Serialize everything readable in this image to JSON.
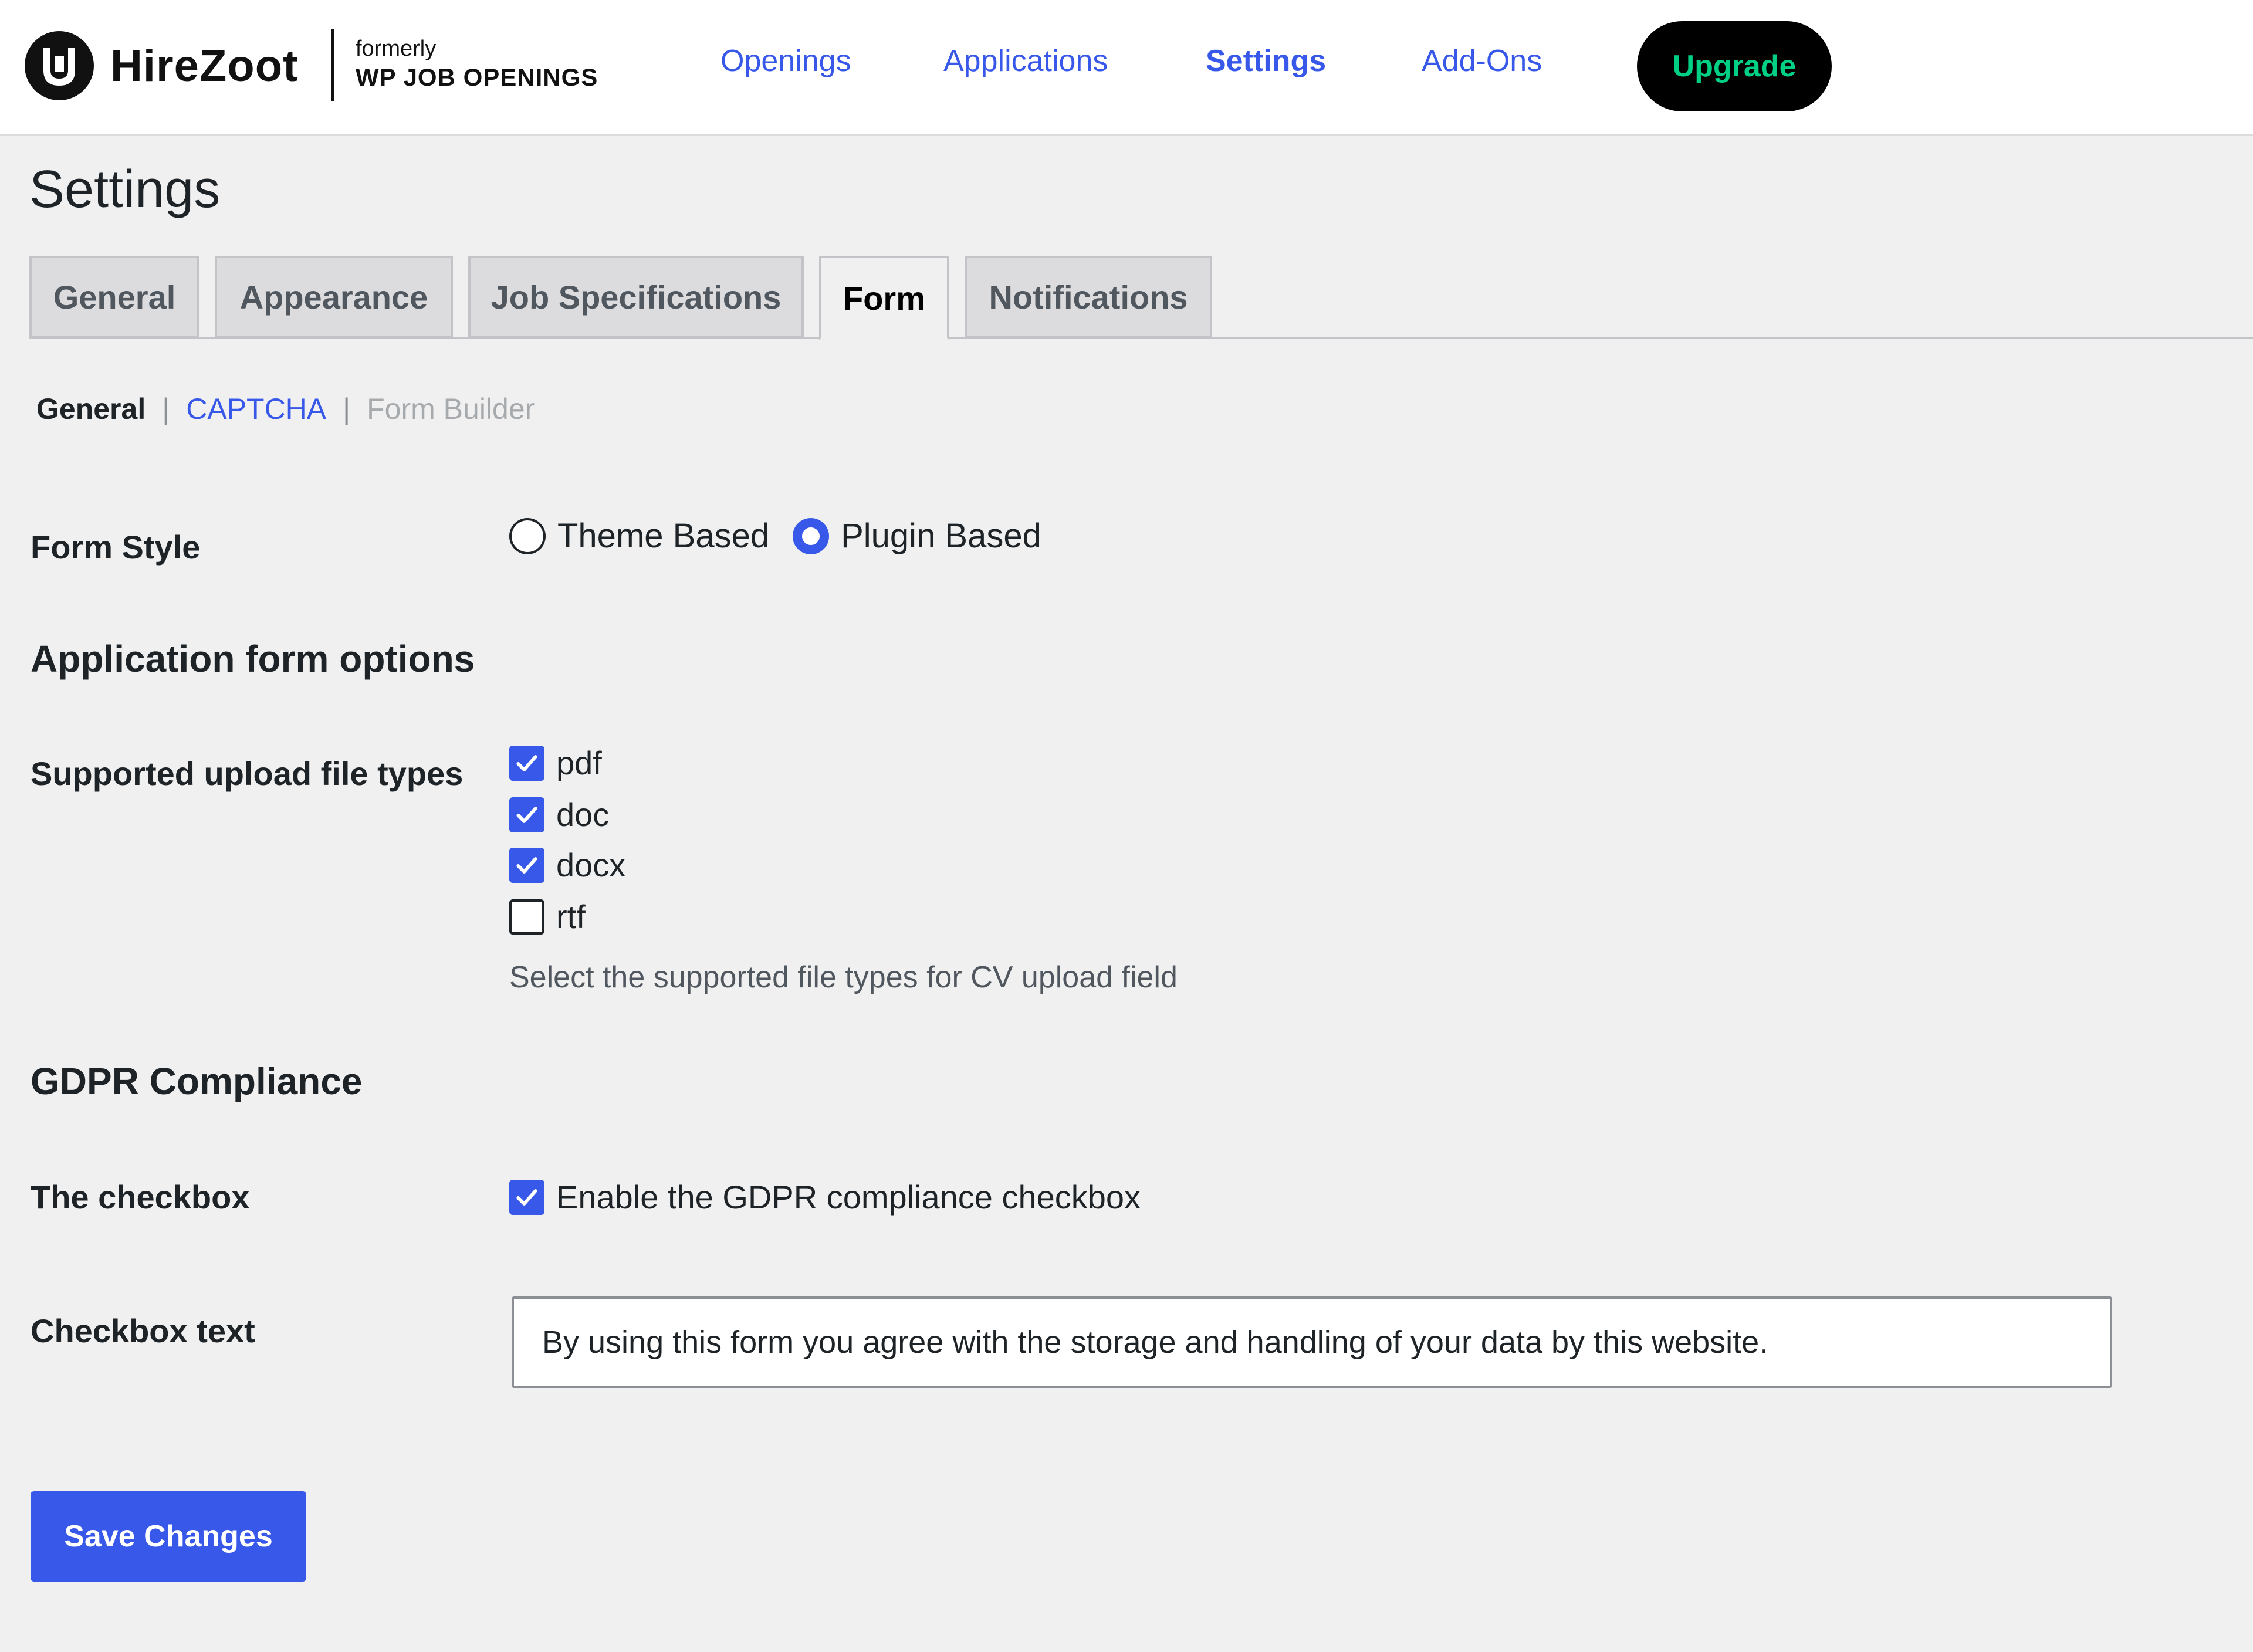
{
  "brand": {
    "name": "HireZoot",
    "formerly": "formerly",
    "old_name": "WP JOB OPENINGS"
  },
  "nav": {
    "items": [
      {
        "label": "Openings",
        "active": false
      },
      {
        "label": "Applications",
        "active": false
      },
      {
        "label": "Settings",
        "active": true
      },
      {
        "label": "Add-Ons",
        "active": false
      }
    ],
    "upgrade_label": "Upgrade"
  },
  "page": {
    "title": "Settings"
  },
  "tabs": [
    {
      "label": "General",
      "active": false
    },
    {
      "label": "Appearance",
      "active": false
    },
    {
      "label": "Job Specifications",
      "active": false
    },
    {
      "label": "Form",
      "active": true
    },
    {
      "label": "Notifications",
      "active": false
    }
  ],
  "subnav": {
    "current": "General",
    "captcha": "CAPTCHA",
    "form_builder": "Form Builder",
    "separator": "|"
  },
  "form_style": {
    "label": "Form Style",
    "options": [
      {
        "label": "Theme Based",
        "selected": false
      },
      {
        "label": "Plugin Based",
        "selected": true
      }
    ]
  },
  "application_options": {
    "heading": "Application form options",
    "file_types_label": "Supported upload file types",
    "file_types": [
      {
        "label": "pdf",
        "checked": true
      },
      {
        "label": "doc",
        "checked": true
      },
      {
        "label": "docx",
        "checked": true
      },
      {
        "label": "rtf",
        "checked": false
      }
    ],
    "description": "Select the supported file types for CV upload field"
  },
  "gdpr": {
    "heading": "GDPR Compliance",
    "checkbox_label": "The checkbox",
    "checkbox_text_option": "Enable the GDPR compliance checkbox",
    "checkbox_enabled": true,
    "text_label": "Checkbox text",
    "text_value": "By using this form you agree with the storage and handling of your data by this website."
  },
  "save_label": "Save Changes",
  "colors": {
    "accent": "#3858e9",
    "upgrade_bg": "#000000",
    "upgrade_text": "#00d084",
    "page_bg": "#f0f0f1"
  }
}
